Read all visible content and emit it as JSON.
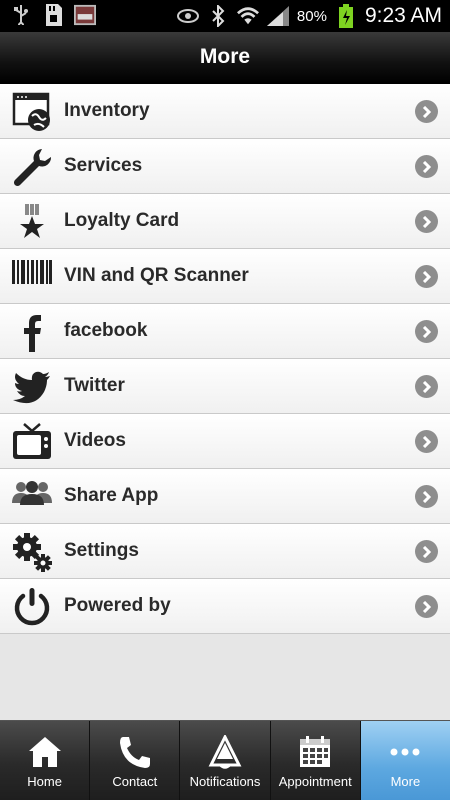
{
  "status_bar": {
    "battery": "80%",
    "time": "9:23 AM",
    "icons": [
      "usb-icon",
      "sd-card-icon",
      "image-thumbnail-icon",
      "eye-icon",
      "bluetooth-icon",
      "wifi-icon",
      "signal-icon",
      "battery-charging-icon"
    ]
  },
  "header": {
    "title": "More"
  },
  "menu": {
    "items": [
      {
        "label": "Inventory",
        "icon": "inventory-globe-icon"
      },
      {
        "label": "Services",
        "icon": "wrench-icon"
      },
      {
        "label": "Loyalty Card",
        "icon": "medal-star-icon"
      },
      {
        "label": "VIN and QR Scanner",
        "icon": "barcode-icon"
      },
      {
        "label": "facebook",
        "icon": "facebook-icon"
      },
      {
        "label": "Twitter",
        "icon": "twitter-bird-icon"
      },
      {
        "label": "Videos",
        "icon": "tv-icon"
      },
      {
        "label": "Share App",
        "icon": "users-icon"
      },
      {
        "label": "Settings",
        "icon": "gears-icon"
      },
      {
        "label": "Powered by",
        "icon": "power-icon"
      }
    ]
  },
  "tabs": {
    "items": [
      {
        "label": "Home",
        "icon": "home-icon",
        "active": false
      },
      {
        "label": "Contact",
        "icon": "phone-icon",
        "active": false
      },
      {
        "label": "Notifications",
        "icon": "megaphone-icon",
        "active": false
      },
      {
        "label": "Appointment",
        "icon": "calendar-icon",
        "active": false
      },
      {
        "label": "More",
        "icon": "more-dots-icon",
        "active": true
      }
    ]
  },
  "colors": {
    "active_tab": "#5da8e0",
    "tab_bar": "#2a2a2a",
    "header": "#111111",
    "chevron": "#8e8e8e"
  }
}
